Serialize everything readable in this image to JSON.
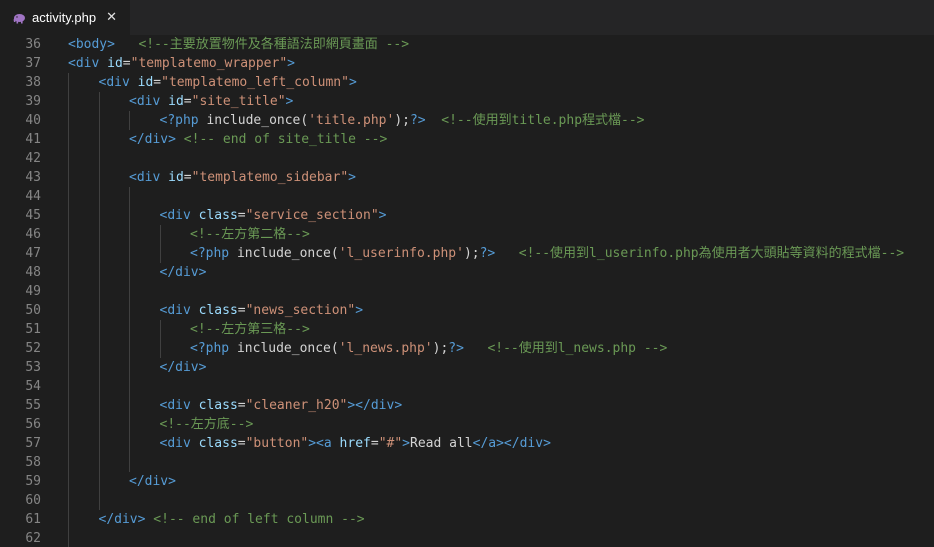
{
  "tab": {
    "filename": "activity.php",
    "close_glyph": "✕",
    "icon": "php-elephant-icon",
    "icon_color": "#a074c4"
  },
  "colors": {
    "background": "#1e1e1e",
    "tag": "#569cd6",
    "attribute": "#9cdcfe",
    "string": "#ce9178",
    "comment": "#6a9955",
    "text": "#d4d4d4",
    "line_number": "#858585"
  },
  "lines": [
    {
      "n": "36",
      "indent": 0,
      "tokens": [
        {
          "t": "tag",
          "v": "<body>"
        },
        {
          "t": "txt",
          "v": "   "
        },
        {
          "t": "cm",
          "v": "<!--主要放置物件及各種語法即網頁畫面 -->"
        }
      ]
    },
    {
      "n": "37",
      "indent": 0,
      "tokens": [
        {
          "t": "tag",
          "v": "<div "
        },
        {
          "t": "attr",
          "v": "id"
        },
        {
          "t": "txt",
          "v": "="
        },
        {
          "t": "str",
          "v": "\"templatemo_wrapper\""
        },
        {
          "t": "tag",
          "v": ">"
        }
      ]
    },
    {
      "n": "38",
      "indent": 1,
      "tokens": [
        {
          "t": "tag",
          "v": "<div "
        },
        {
          "t": "attr",
          "v": "id"
        },
        {
          "t": "txt",
          "v": "="
        },
        {
          "t": "str",
          "v": "\"templatemo_left_column\""
        },
        {
          "t": "tag",
          "v": ">"
        }
      ]
    },
    {
      "n": "39",
      "indent": 2,
      "tokens": [
        {
          "t": "tag",
          "v": "<div "
        },
        {
          "t": "attr",
          "v": "id"
        },
        {
          "t": "txt",
          "v": "="
        },
        {
          "t": "str",
          "v": "\"site_title\""
        },
        {
          "t": "tag",
          "v": ">"
        }
      ]
    },
    {
      "n": "40",
      "indent": 3,
      "tokens": [
        {
          "t": "tag",
          "v": "<?php "
        },
        {
          "t": "txt",
          "v": "include_once("
        },
        {
          "t": "str",
          "v": "'title.php'"
        },
        {
          "t": "txt",
          "v": ");"
        },
        {
          "t": "tag",
          "v": "?>"
        },
        {
          "t": "txt",
          "v": "  "
        },
        {
          "t": "cm",
          "v": "<!--使用到title.php程式檔-->"
        }
      ]
    },
    {
      "n": "41",
      "indent": 2,
      "tokens": [
        {
          "t": "tag",
          "v": "</div>"
        },
        {
          "t": "txt",
          "v": " "
        },
        {
          "t": "cm",
          "v": "<!-- end of site_title -->"
        }
      ]
    },
    {
      "n": "42",
      "indent": 0,
      "tokens": []
    },
    {
      "n": "43",
      "indent": 2,
      "tokens": [
        {
          "t": "tag",
          "v": "<div "
        },
        {
          "t": "attr",
          "v": "id"
        },
        {
          "t": "txt",
          "v": "="
        },
        {
          "t": "str",
          "v": "\"templatemo_sidebar\""
        },
        {
          "t": "tag",
          "v": ">"
        }
      ]
    },
    {
      "n": "44",
      "indent": 0,
      "tokens": []
    },
    {
      "n": "45",
      "indent": 3,
      "tokens": [
        {
          "t": "tag",
          "v": "<div "
        },
        {
          "t": "attr",
          "v": "class"
        },
        {
          "t": "txt",
          "v": "="
        },
        {
          "t": "str",
          "v": "\"service_section\""
        },
        {
          "t": "tag",
          "v": ">"
        }
      ]
    },
    {
      "n": "46",
      "indent": 4,
      "tokens": [
        {
          "t": "cm",
          "v": "<!--左方第二格-->"
        }
      ]
    },
    {
      "n": "47",
      "indent": 4,
      "tokens": [
        {
          "t": "tag",
          "v": "<?php "
        },
        {
          "t": "txt",
          "v": "include_once("
        },
        {
          "t": "str",
          "v": "'l_userinfo.php'"
        },
        {
          "t": "txt",
          "v": ");"
        },
        {
          "t": "tag",
          "v": "?>"
        },
        {
          "t": "txt",
          "v": "   "
        },
        {
          "t": "cm",
          "v": "<!--使用到l_userinfo.php為使用者大頭貼等資料的程式檔-->"
        }
      ]
    },
    {
      "n": "48",
      "indent": 3,
      "tokens": [
        {
          "t": "tag",
          "v": "</div>"
        }
      ]
    },
    {
      "n": "49",
      "indent": 0,
      "tokens": []
    },
    {
      "n": "50",
      "indent": 3,
      "tokens": [
        {
          "t": "tag",
          "v": "<div "
        },
        {
          "t": "attr",
          "v": "class"
        },
        {
          "t": "txt",
          "v": "="
        },
        {
          "t": "str",
          "v": "\"news_section\""
        },
        {
          "t": "tag",
          "v": ">"
        }
      ]
    },
    {
      "n": "51",
      "indent": 4,
      "tokens": [
        {
          "t": "cm",
          "v": "<!--左方第三格-->"
        }
      ]
    },
    {
      "n": "52",
      "indent": 4,
      "tokens": [
        {
          "t": "tag",
          "v": "<?php "
        },
        {
          "t": "txt",
          "v": "include_once("
        },
        {
          "t": "str",
          "v": "'l_news.php'"
        },
        {
          "t": "txt",
          "v": ");"
        },
        {
          "t": "tag",
          "v": "?>"
        },
        {
          "t": "txt",
          "v": "   "
        },
        {
          "t": "cm",
          "v": "<!--使用到l_news.php -->"
        }
      ]
    },
    {
      "n": "53",
      "indent": 3,
      "tokens": [
        {
          "t": "tag",
          "v": "</div>"
        }
      ]
    },
    {
      "n": "54",
      "indent": 0,
      "tokens": []
    },
    {
      "n": "55",
      "indent": 3,
      "tokens": [
        {
          "t": "tag",
          "v": "<div "
        },
        {
          "t": "attr",
          "v": "class"
        },
        {
          "t": "txt",
          "v": "="
        },
        {
          "t": "str",
          "v": "\"cleaner_h20\""
        },
        {
          "t": "tag",
          "v": "></div>"
        }
      ]
    },
    {
      "n": "56",
      "indent": 3,
      "tokens": [
        {
          "t": "cm",
          "v": "<!--左方底-->"
        }
      ]
    },
    {
      "n": "57",
      "indent": 3,
      "tokens": [
        {
          "t": "tag",
          "v": "<div "
        },
        {
          "t": "attr",
          "v": "class"
        },
        {
          "t": "txt",
          "v": "="
        },
        {
          "t": "str",
          "v": "\"button\""
        },
        {
          "t": "tag",
          "v": "><a "
        },
        {
          "t": "attr",
          "v": "href"
        },
        {
          "t": "txt",
          "v": "="
        },
        {
          "t": "str",
          "v": "\"#\""
        },
        {
          "t": "tag",
          "v": ">"
        },
        {
          "t": "txt",
          "v": "Read all"
        },
        {
          "t": "tag",
          "v": "</a></div>"
        }
      ]
    },
    {
      "n": "58",
      "indent": 0,
      "tokens": []
    },
    {
      "n": "59",
      "indent": 2,
      "tokens": [
        {
          "t": "tag",
          "v": "</div>"
        }
      ]
    },
    {
      "n": "60",
      "indent": 0,
      "tokens": []
    },
    {
      "n": "61",
      "indent": 1,
      "tokens": [
        {
          "t": "tag",
          "v": "</div>"
        },
        {
          "t": "txt",
          "v": " "
        },
        {
          "t": "cm",
          "v": "<!-- end of left column -->"
        }
      ]
    },
    {
      "n": "62",
      "indent": 0,
      "tokens": []
    }
  ]
}
